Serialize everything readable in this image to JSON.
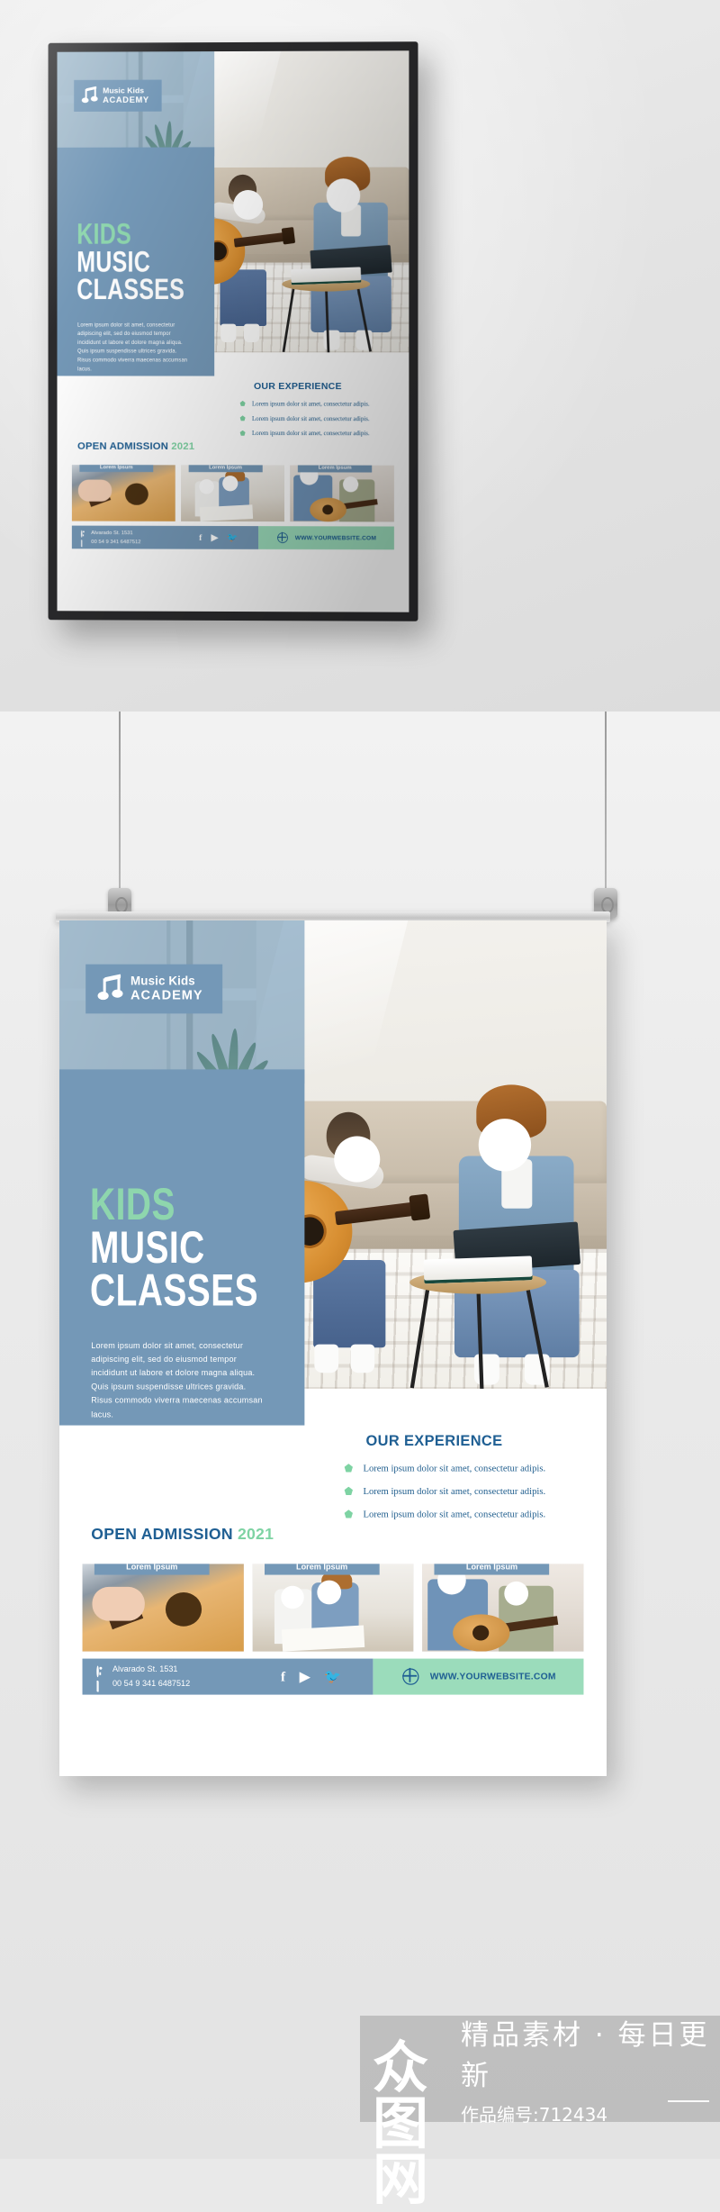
{
  "brand": {
    "logo_icon": "music-note-icon",
    "line1": "Music Kids",
    "line2": "ACADEMY",
    "blue": "#7498b7",
    "mint": "#8ed6ad",
    "deep_blue": "#1f5f93",
    "footer_green": "#9bdcbb"
  },
  "headline": {
    "line1": "KIDS",
    "line2": "MUSIC",
    "line3": "CLASSES"
  },
  "body_copy": "Lorem ipsum dolor sit amet, consectetur adipiscing elit, sed do eiusmod tempor incididunt ut labore et dolore magna aliqua. Quis ipsum suspendisse ultrices gravida. Risus commodo viverra maecenas accumsan lacus.",
  "experience": {
    "title": "OUR EXPERIENCE",
    "items": [
      "Lorem ipsum dolor sit amet, consectetur adipis.",
      "Lorem ipsum dolor sit amet, consectetur adipis.",
      "Lorem ipsum dolor sit amet, consectetur adipis."
    ]
  },
  "admission": {
    "label": "OPEN ADMISSION",
    "year": "2021"
  },
  "thumbnails": [
    {
      "caption": "Lorem Ipsum"
    },
    {
      "caption": "Lorem Ipsum"
    },
    {
      "caption": "Lorem Ipsum"
    }
  ],
  "footer": {
    "address": "Alvarado St. 1531",
    "phone": "00 54 9 341 6487512",
    "address_icon": "location-pin-icon",
    "phone_icon": "phone-icon",
    "socials": [
      {
        "name": "facebook-icon",
        "glyph": "f"
      },
      {
        "name": "youtube-icon",
        "glyph": "▶"
      },
      {
        "name": "twitter-icon",
        "glyph": "🐦"
      }
    ],
    "website_icon": "globe-icon",
    "website": "WWW.YOURWEBSITE.COM"
  },
  "watermark": {
    "logo_text": "众图网",
    "tagline": "精品素材 · 每日更新",
    "code": "作品编号:712434"
  }
}
